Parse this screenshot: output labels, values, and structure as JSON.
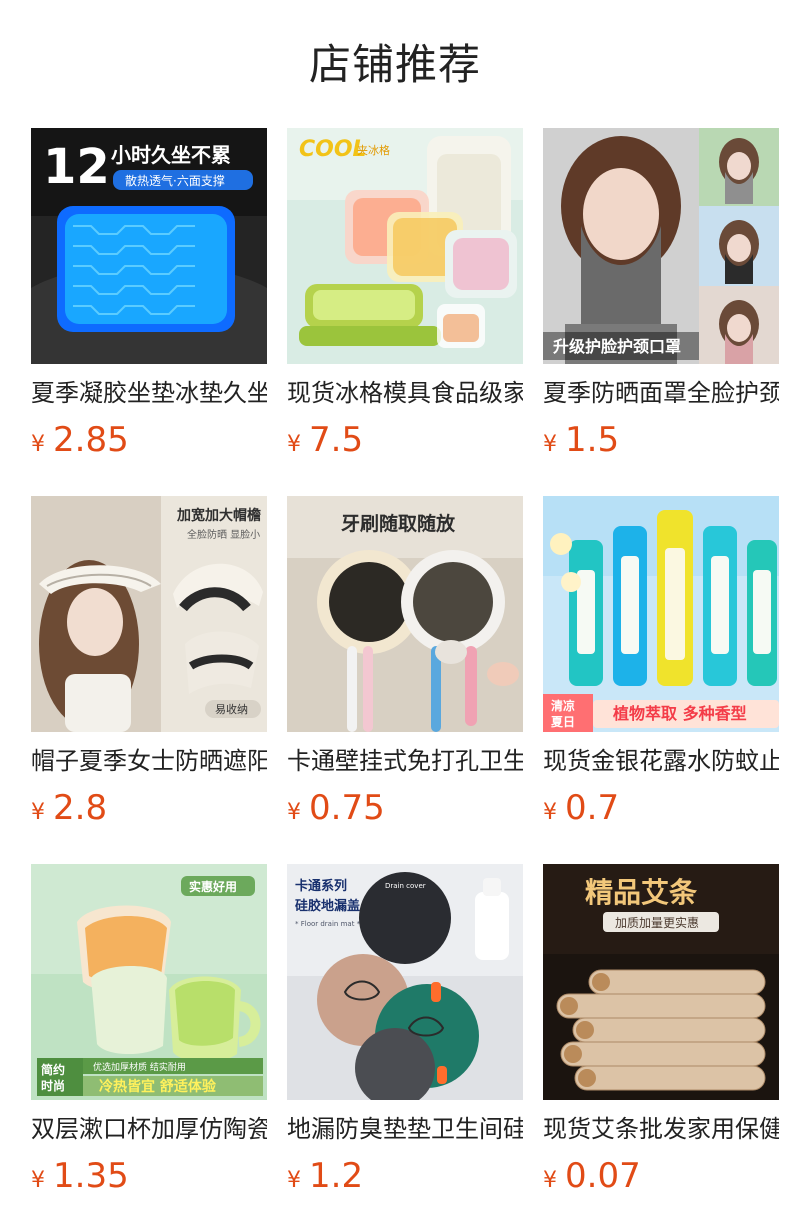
{
  "header": {
    "title": "店铺推荐"
  },
  "currency_symbol": "¥",
  "products": [
    {
      "name": "夏季凝胶坐垫冰垫久坐",
      "price": "2.85",
      "image": {
        "big_number": "12",
        "headline": "小时久坐不累",
        "subtitle": "散热透气·六面支撑"
      }
    },
    {
      "name": "现货冰格模具食品级家用",
      "price": "7.5",
      "image": {
        "brand_text": "COOL",
        "brand_suffix": "夹冰格"
      }
    },
    {
      "name": "夏季防晒面罩全脸护颈",
      "price": "1.5",
      "image": {
        "caption": "升级护脸护颈口罩"
      }
    },
    {
      "name": "帽子夏季女士防晒遮阳帽",
      "price": "2.8",
      "image": {
        "headline": "加宽加大帽檐",
        "subtitle": "全脸防晒 显脸小",
        "tag": "易收纳"
      }
    },
    {
      "name": "卡通壁挂式免打孔卫生间",
      "price": "0.75",
      "image": {
        "headline": "牙刷随取随放"
      }
    },
    {
      "name": "现货金银花露水防蚊止痒",
      "price": "0.7",
      "image": {
        "badge_line1": "清凉",
        "badge_line2": "夏日",
        "banner": "植物萃取 多种香型"
      }
    },
    {
      "name": "双层漱口杯加厚仿陶瓷",
      "price": "1.35",
      "image": {
        "tag": "实惠好用",
        "badge_line1": "简约",
        "badge_line2": "时尚",
        "small_text": "优选加厚材质 结实耐用",
        "banner": "冷热皆宜 舒适体验"
      }
    },
    {
      "name": "地漏防臭垫垫卫生间硅胶",
      "price": "1.2",
      "image": {
        "headline_line1": "卡通系列",
        "headline_line2": "硅胶地漏盖",
        "small_text": "* Floor drain mat *",
        "product_text": "Drain cover"
      }
    },
    {
      "name": "现货艾条批发家用保健",
      "price": "0.07",
      "image": {
        "headline": "精品艾条",
        "subtitle": "加质加量更实惠"
      }
    }
  ]
}
